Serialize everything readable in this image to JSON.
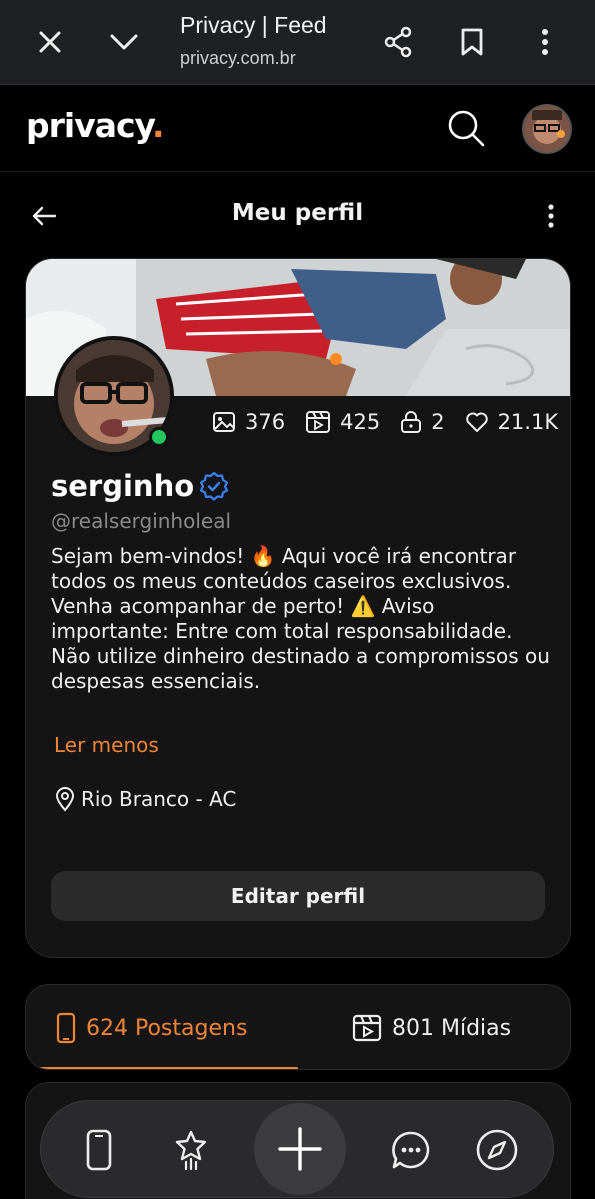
{
  "browser": {
    "title": "Privacy | Feed",
    "url": "privacy.com.br"
  },
  "app": {
    "logo_text": "privacy",
    "logo_dot": ".",
    "accent_color": "#f08537"
  },
  "page": {
    "title": "Meu perfil"
  },
  "profile": {
    "display_name": "serginho",
    "handle": "@realserginholeal",
    "bio": "Sejam bem-vindos! 🔥 Aqui você irá encontrar todos os meus conteúdos caseiros exclusivos. Venha acompanhar de perto! ⚠️ Aviso importante: Entre com total responsabilidade. Não utilize dinheiro destinado a compromissos ou despesas essenciais.",
    "read_less": "Ler menos",
    "location": "Rio Branco - AC",
    "edit_button": "Editar perfil",
    "stats": {
      "photos": "376",
      "videos": "425",
      "locked": "2",
      "likes": "21.1K"
    }
  },
  "tabs": {
    "posts": "624 Postagens",
    "media": "801 Mídias"
  },
  "icons": [
    "close-icon",
    "chevron-down-icon",
    "share-icon",
    "bookmark-icon",
    "more-vertical-icon",
    "search-icon",
    "back-arrow-icon",
    "image-icon",
    "video-icon",
    "lock-icon",
    "heart-icon",
    "verified-icon",
    "location-icon",
    "phone-icon",
    "star-icon",
    "plus-icon",
    "chat-icon",
    "compass-icon"
  ]
}
